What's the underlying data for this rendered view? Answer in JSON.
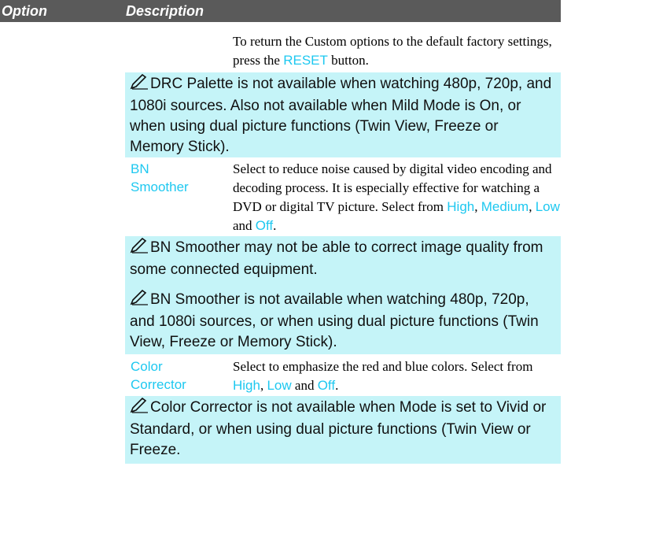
{
  "header": {
    "option_label": "Option",
    "description_label": "Description"
  },
  "reset_text": {
    "before": "To return the Custom options to the default factory settings, press the ",
    "highlight": "RESET",
    "after": " button."
  },
  "notes": [
    "DRC Palette is not available when watching 480p, 720p, and 1080i sources. Also not available when Mild Mode is On, or when using dual picture functions (Twin View, Freeze or Memory Stick).",
    "BN Smoother may not be able to correct image quality from some connected equipment.",
    "BN Smoother is not available when watching 480p, 720p, and 1080i sources, or when using dual picture functions (Twin View, Freeze or Memory Stick).",
    "Color Corrector is not available when Mode is set to Vivid or Standard, or when using dual picture functions (Twin View or Freeze."
  ],
  "bn_smoother": {
    "option_line1": "BN",
    "option_line2": "Smoother",
    "desc": "Select to reduce noise caused by digital video encoding and decoding process. It is especially effective for watching a DVD or digital TV picture. Select from ",
    "opt_high": "High",
    "sep1": ", ",
    "opt_medium": "Medium",
    "sep2": ", ",
    "opt_low": "Low",
    "sep3": " and ",
    "opt_off": "Off",
    "end": "."
  },
  "color_corrector": {
    "option_line1": "Color",
    "option_line2": "Corrector",
    "desc": "Select to emphasize the red and blue colors. Select from ",
    "opt_high": "High",
    "sep1": ", ",
    "opt_low": "Low",
    "sep2": " and ",
    "opt_off": "Off",
    "end": "."
  },
  "colors": {
    "header_bg": "#5a5a5a",
    "note_bg": "#c5f4f8",
    "highlight": "#1ec8f0"
  },
  "icons": {
    "note": "pencil-note-icon"
  }
}
